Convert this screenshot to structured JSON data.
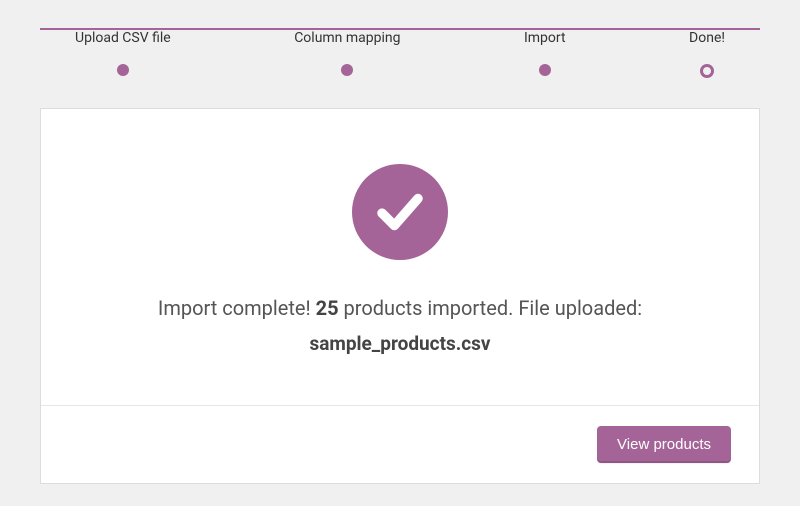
{
  "steps": [
    {
      "label": "Upload CSV file",
      "active": false
    },
    {
      "label": "Column mapping",
      "active": false
    },
    {
      "label": "Import",
      "active": false
    },
    {
      "label": "Done!",
      "active": true
    }
  ],
  "result": {
    "prefix": "Import complete! ",
    "count": "25",
    "suffix": " products imported. File uploaded:",
    "filename": "sample_products.csv"
  },
  "buttons": {
    "view_products": "View products"
  },
  "colors": {
    "accent": "#a46497"
  }
}
